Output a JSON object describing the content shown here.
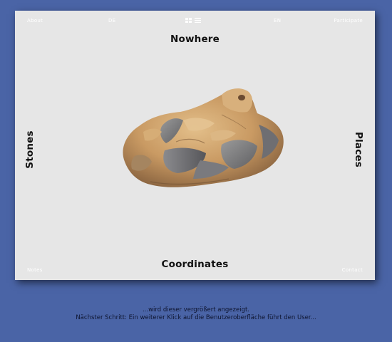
{
  "top_nav": {
    "about": "About",
    "lang_de": "DE",
    "lang_en": "EN",
    "participate": "Participate",
    "view_grid_icon": "grid-view-icon",
    "view_list_icon": "list-view-icon"
  },
  "bottom_nav": {
    "notes": "Notes",
    "contact": "Contact"
  },
  "main_nav": {
    "top": "Nowhere",
    "left": "Stones",
    "right": "Places",
    "bottom": "Coordinates"
  },
  "stone_image": "stone-image",
  "captions": {
    "line1": "...wird dieser vergrößert angezeigt.",
    "line2": "Nächster Schritt: Ein weiterer Klick auf die Benutzeroberfläche führt den User..."
  },
  "colors": {
    "background": "#4a64a6",
    "page": "#e6e6e6",
    "nav_text": "#111111",
    "corner_text": "#ffffff",
    "caption_text": "#0e1530"
  }
}
